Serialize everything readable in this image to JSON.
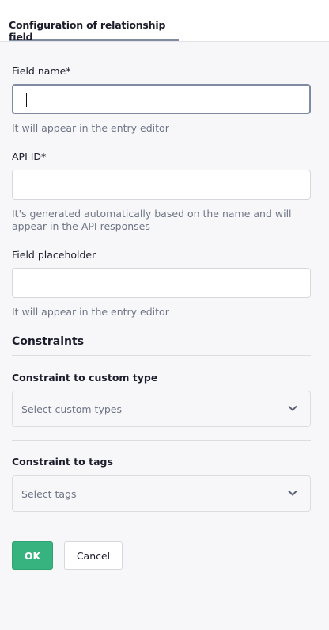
{
  "header": {
    "tab_label": "Configuration of relationship field"
  },
  "form": {
    "field_name": {
      "label": "Field name*",
      "value": "",
      "help": "It will appear in the entry editor"
    },
    "api_id": {
      "label": "API ID*",
      "value": "",
      "help": "It's generated automatically based on the name and will appear in the API responses"
    },
    "field_placeholder": {
      "label": "Field placeholder",
      "value": "",
      "help": "It will appear in the entry editor"
    }
  },
  "constraints": {
    "heading": "Constraints",
    "custom_type": {
      "label": "Constraint to custom type",
      "placeholder": "Select custom types"
    },
    "tags": {
      "label": "Constraint to tags",
      "placeholder": "Select tags"
    }
  },
  "actions": {
    "ok": "OK",
    "cancel": "Cancel"
  },
  "colors": {
    "primary": "#36b37e",
    "focus_border": "#818ba0"
  }
}
